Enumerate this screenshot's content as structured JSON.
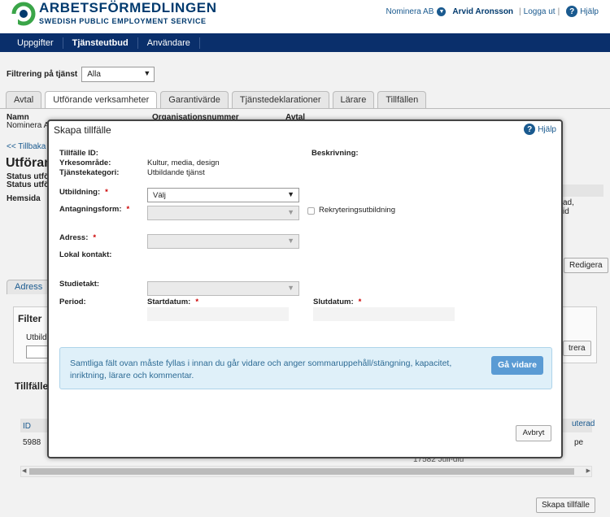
{
  "brand": {
    "name": "ARBETSFÖRMEDLINGEN",
    "tagline": "SWEDISH PUBLIC EMPLOYMENT SERVICE",
    "color": "#003a6e"
  },
  "user_bar": {
    "org": "Nominera AB",
    "user": "Arvid Aronsson",
    "logout": "Logga ut",
    "help": "Hjälp"
  },
  "nav": {
    "items": [
      "Uppgifter",
      "Tjänsteutbud",
      "Användare"
    ],
    "active_index": 1
  },
  "filter": {
    "label": "Filtrering på tjänst",
    "value": "Alla"
  },
  "tabs": {
    "items": [
      "Avtal",
      "Utförande verksamheter",
      "Garantivärde",
      "Tjänstedeklarationer",
      "Lärare",
      "Tillfällen"
    ],
    "active_index": 1
  },
  "background": {
    "col_namn": "Namn",
    "col_org": "Organisationsnummer",
    "col_avtal": "Avtal",
    "org_row": "Nominera A",
    "back_link": "<< Tillbaka",
    "heading": "Utföran",
    "status1": "Status utfö",
    "status2": "Status utfö",
    "hemsida": "Hemsida",
    "right_text1": "ad,",
    "right_text2": "id",
    "edit_btn": "Redigera",
    "address_tab": "Adress",
    "filter_heading": "Filter",
    "filter_sub": "Utbild",
    "filter_btn": "trera",
    "tillfalle_heading": "Tillfälle",
    "table_id": "ID",
    "table_right": "uterad",
    "row_id": "5988",
    "row_right": "pe",
    "row_date": "17582 Juli-diu",
    "create_btn": "Skapa tillfälle"
  },
  "modal": {
    "title": "Skapa tillfälle",
    "help": "Hjälp",
    "tillfalle_id_label": "Tillfälle ID:",
    "yrkesomrade_label": "Yrkesområde:",
    "yrkesomrade_value": "Kultur, media, design",
    "tjanstekategori_label": "Tjänstekategori:",
    "tjanstekategori_value": "Utbildande tjänst",
    "beskrivning_label": "Beskrivning:",
    "utbildning_label": "Utbildning:",
    "utbildning_value": "Välj",
    "antagningsform_label": "Antagningsform:",
    "rekrytering_label": "Rekryteringsutbildning",
    "adress_label": "Adress:",
    "lokal_kontakt_label": "Lokal kontakt:",
    "studietakt_label": "Studietakt:",
    "period_label": "Period:",
    "startdatum_label": "Startdatum:",
    "slutdatum_label": "Slutdatum:",
    "required_mark": "*",
    "info_text": "Samtliga fält ovan måste fyllas i innan du går vidare och anger sommaruppehåll/stängning, kapacitet, inriktning, lärare och kommentar.",
    "go_button": "Gå vidare",
    "cancel_button": "Avbryt",
    "colors": {
      "info_bg": "#dff0f9",
      "info_text": "#2d6b95",
      "go_btn": "#5a9bd4",
      "required": "#cc0000"
    }
  }
}
